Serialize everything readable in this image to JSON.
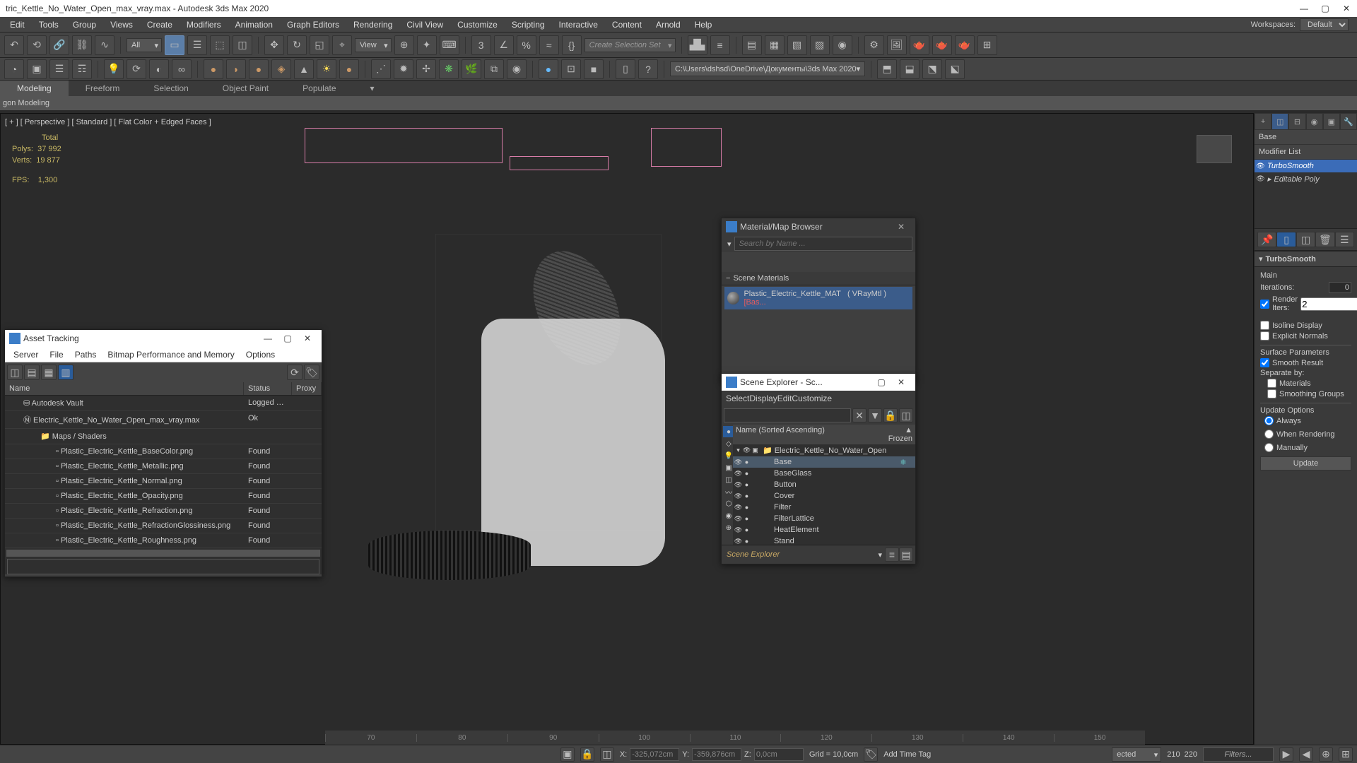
{
  "title": "tric_Kettle_No_Water_Open_max_vray.max - Autodesk 3ds Max 2020",
  "menu": [
    "Edit",
    "Tools",
    "Group",
    "Views",
    "Create",
    "Modifiers",
    "Animation",
    "Graph Editors",
    "Rendering",
    "Civil View",
    "Customize",
    "Scripting",
    "Interactive",
    "Content",
    "Arnold",
    "Help"
  ],
  "workspaces_label": "Workspaces:",
  "workspaces_value": "Default",
  "toolbar": {
    "all_filter": "All",
    "view_label": "View",
    "selection_set": "Create Selection Set",
    "path": "C:\\Users\\dshsd\\OneDrive\\Документы\\3ds Max 2020"
  },
  "ribbon_tabs": [
    "Modeling",
    "Freeform",
    "Selection",
    "Object Paint",
    "Populate"
  ],
  "ribbon_sub": "gon Modeling",
  "viewport": {
    "label": "[ + ] [ Perspective ] [ Standard ] [ Flat Color + Edged Faces ]",
    "stats_total": "Total",
    "stats_polys_label": "Polys:",
    "stats_polys": "37 992",
    "stats_verts_label": "Verts:",
    "stats_verts": "19 877",
    "fps_label": "FPS:",
    "fps": "1,300"
  },
  "cmd_panel": {
    "object_name": "Base",
    "modifier_list_label": "Modifier List",
    "modifiers": [
      "TurboSmooth",
      "Editable Poly"
    ],
    "rollout_title": "TurboSmooth",
    "main_label": "Main",
    "iterations_label": "Iterations:",
    "iterations": "0",
    "render_iters_label": "Render Iters:",
    "render_iters": "2",
    "isoline": "Isoline Display",
    "explicit": "Explicit Normals",
    "surf_params": "Surface Parameters",
    "smooth_result": "Smooth Result",
    "separate_by": "Separate by:",
    "materials": "Materials",
    "smoothing_groups": "Smoothing Groups",
    "update_options": "Update Options",
    "update_always": "Always",
    "update_rendering": "When Rendering",
    "update_manually": "Manually",
    "update_btn": "Update"
  },
  "asset_tracking": {
    "title": "Asset Tracking",
    "menu": [
      "Server",
      "File",
      "Paths",
      "Bitmap Performance and Memory",
      "Options"
    ],
    "columns": [
      "Name",
      "Status",
      "Proxy"
    ],
    "rows": [
      {
        "name": "Autodesk Vault",
        "status": "Logged O...",
        "indent": 1,
        "icon": "vault"
      },
      {
        "name": "Electric_Kettle_No_Water_Open_max_vray.max",
        "status": "Ok",
        "indent": 1,
        "icon": "max"
      },
      {
        "name": "Maps / Shaders",
        "status": "",
        "indent": 2,
        "icon": "folder"
      },
      {
        "name": "Plastic_Electric_Kettle_BaseColor.png",
        "status": "Found",
        "indent": 3,
        "icon": "file"
      },
      {
        "name": "Plastic_Electric_Kettle_Metallic.png",
        "status": "Found",
        "indent": 3,
        "icon": "file"
      },
      {
        "name": "Plastic_Electric_Kettle_Normal.png",
        "status": "Found",
        "indent": 3,
        "icon": "file"
      },
      {
        "name": "Plastic_Electric_Kettle_Opacity.png",
        "status": "Found",
        "indent": 3,
        "icon": "file"
      },
      {
        "name": "Plastic_Electric_Kettle_Refraction.png",
        "status": "Found",
        "indent": 3,
        "icon": "file"
      },
      {
        "name": "Plastic_Electric_Kettle_RefractionGlossiness.png",
        "status": "Found",
        "indent": 3,
        "icon": "file"
      },
      {
        "name": "Plastic_Electric_Kettle_Roughness.png",
        "status": "Found",
        "indent": 3,
        "icon": "file"
      }
    ]
  },
  "material_browser": {
    "title": "Material/Map Browser",
    "search_placeholder": "Search by Name ...",
    "section": "Scene Materials",
    "material_name": "Plastic_Electric_Kettle_MAT",
    "material_type": "( VRayMtl )",
    "material_suffix": "[Bas..."
  },
  "scene_explorer": {
    "title": "Scene Explorer - Sc...",
    "menu": [
      "Select",
      "Display",
      "Edit",
      "Customize"
    ],
    "col_name": "Name (Sorted Ascending)",
    "col_frozen": "▲ Frozen",
    "root": "Electric_Kettle_No_Water_Open",
    "items": [
      "Base",
      "BaseGlass",
      "Button",
      "Cover",
      "Filter",
      "FilterLattice",
      "HeatElement",
      "Stand"
    ],
    "footer": "Scene Explorer"
  },
  "status": {
    "selected_dropdown": "ected",
    "x_label": "X:",
    "x": "-325,072cm",
    "y_label": "Y:",
    "y": "-359,876cm",
    "z_label": "Z:",
    "z": "0,0cm",
    "grid": "Grid = 10,0cm",
    "add_time_tag": "Add Time Tag",
    "filters": "Filters..."
  },
  "timeline_ticks": [
    "70",
    "80",
    "90",
    "100",
    "110",
    "120",
    "130",
    "140",
    "150"
  ],
  "timeline_right": [
    "210",
    "220"
  ]
}
